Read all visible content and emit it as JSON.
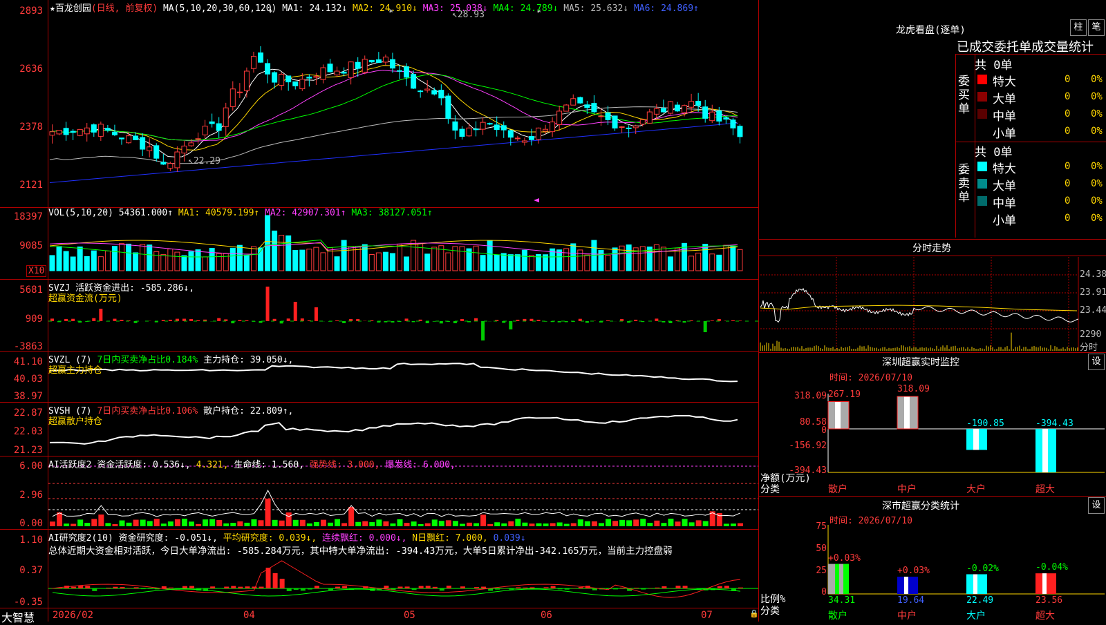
{
  "main": {
    "stock_name": "百龙创园",
    "mode": "(日线, 前复权)",
    "ma_label": "MA(5,10,20,30,60,120)",
    "ma": [
      {
        "label": "MA1: 24.132↓",
        "color": "#ffffff"
      },
      {
        "label": "MA2: 24.910↓",
        "color": "#ffd700"
      },
      {
        "label": "MA3: 25.038↓",
        "color": "#ff40ff"
      },
      {
        "label": "MA4: 24.789↓",
        "color": "#00ff00"
      },
      {
        "label": "MA5: 25.632↓",
        "color": "#bbbbbb"
      },
      {
        "label": "MA6: 24.869↑",
        "color": "#4060ff"
      }
    ],
    "y_ticks": [
      "2893",
      "2636",
      "2378",
      "2121"
    ],
    "high_label": "28.93",
    "low_label": "22.29"
  },
  "vol": {
    "label": "VOL(5,10,20)",
    "value": "54361.000↑",
    "ma": [
      {
        "label": "MA1: 40579.199↑",
        "color": "#ffd700"
      },
      {
        "label": "MA2: 42907.301↑",
        "color": "#ff40ff"
      },
      {
        "label": "MA3: 38127.051↑",
        "color": "#00ff00"
      }
    ],
    "y_ticks": [
      "18397",
      "9085"
    ],
    "unit": "X10"
  },
  "svzj": {
    "label": "SVZJ",
    "desc": "活跃资金进出: -585.286↓,",
    "title": "超赢资金流(万元)",
    "y_ticks": [
      "5681",
      "909",
      "-3863"
    ]
  },
  "svzl": {
    "label": "SVZL (7)",
    "desc": "7日内买卖净占比0.184%",
    "hold": "主力持仓: 39.050↓,",
    "title": "超赢主力持仓",
    "y_ticks": [
      "41.10",
      "40.03",
      "38.97"
    ]
  },
  "svsh": {
    "label": "SVSH (7)",
    "desc": "7日内买卖净占比0.106%",
    "hold": "散户持仓: 22.809↑,",
    "title": "超赢散户持仓",
    "y_ticks": [
      "22.87",
      "22.03",
      "21.23"
    ]
  },
  "ai1": {
    "label": "AI活跃度2",
    "v1": "资金活跃度: 0.536↓,",
    "v2": "4.321,",
    "v3": "生命线: 1.560,",
    "v4": "强势线: 3.000,",
    "v5": "爆发线: 6.000,",
    "y_ticks": [
      "6.00",
      "2.96",
      "0.00"
    ]
  },
  "ai2": {
    "label": "AI研究度2(10)",
    "v1": "资金研究度: -0.051↓,",
    "v2": "平均研究度: 0.039↓,",
    "v3": "连续飘红: 0.000↓,",
    "v4": "N日飘红: 7.000,",
    "v5": "0.039↓",
    "summary": "总体近期大资金相对活跃，今日大单净流出: -585.284万元，其中特大单净流出: -394.43万元，大单5日累计净出-342.165万元，当前主力控盘弱",
    "y_ticks": [
      "1.10",
      "0.37",
      "-0.35"
    ]
  },
  "bottom": {
    "brand": "大智慧",
    "dates": [
      "2026/02",
      "04",
      "05",
      "06",
      "07"
    ]
  },
  "right": {
    "lhb_title": "龙虎看盘(逐单)",
    "btn_zhu": "柱",
    "btn_bi": "笔",
    "header": "已成交委托单成交量统计",
    "buy_label": "委买单",
    "sell_label": "委卖单",
    "buy_total": "共 0单",
    "sell_total": "共 0单",
    "buy_rows": [
      {
        "name": "特大",
        "count": "0",
        "pct": "0%",
        "color": "#ff0000"
      },
      {
        "name": "大单",
        "count": "0",
        "pct": "0%",
        "color": "#8b0000"
      },
      {
        "name": "中单",
        "count": "0",
        "pct": "0%",
        "color": "#5a0000"
      },
      {
        "name": "小单",
        "count": "0",
        "pct": "0%",
        "color": ""
      }
    ],
    "sell_rows": [
      {
        "name": "特大",
        "count": "0",
        "pct": "0%",
        "color": "#00ffff"
      },
      {
        "name": "大单",
        "count": "0",
        "pct": "0%",
        "color": "#008b8b"
      },
      {
        "name": "中单",
        "count": "0",
        "pct": "0%",
        "color": "#006b6b"
      },
      {
        "name": "小单",
        "count": "0",
        "pct": "0%",
        "color": ""
      }
    ],
    "fenshi_title": "分时走势",
    "fenshi_ticks": [
      "24.38",
      "23.91",
      "23.44",
      "2290",
      "分时"
    ],
    "monitor_title": "深圳超赢实时监控",
    "btn_set1": "设",
    "monitor_time": "时间: 2026/07/10",
    "monitor_y": [
      "318.09",
      "80.58",
      "0",
      "-156.92",
      "-394.43"
    ],
    "monitor_unit": "净额(万元)",
    "monitor_cat_label": "分类",
    "monitor_bars": [
      {
        "cat": "散户",
        "value": "267.19"
      },
      {
        "cat": "中户",
        "value": "318.09"
      },
      {
        "cat": "大户",
        "value": "-190.85"
      },
      {
        "cat": "超大",
        "value": "-394.43"
      }
    ],
    "stats_title": "深市超赢分类统计",
    "btn_set2": "设",
    "stats_time": "时间: 2026/07/10",
    "stats_y": [
      "75",
      "50",
      "25",
      "0"
    ],
    "stats_unit": "比例%",
    "stats_cat_label": "分类",
    "stats_bars": [
      {
        "cat": "散户",
        "pct": "34.31",
        "chg": "+0.03%"
      },
      {
        "cat": "中户",
        "pct": "19.64",
        "chg": "+0.03%"
      },
      {
        "cat": "大户",
        "pct": "22.49",
        "chg": "-0.02%"
      },
      {
        "cat": "超大",
        "pct": "23.56",
        "chg": "-0.04%"
      }
    ]
  }
}
